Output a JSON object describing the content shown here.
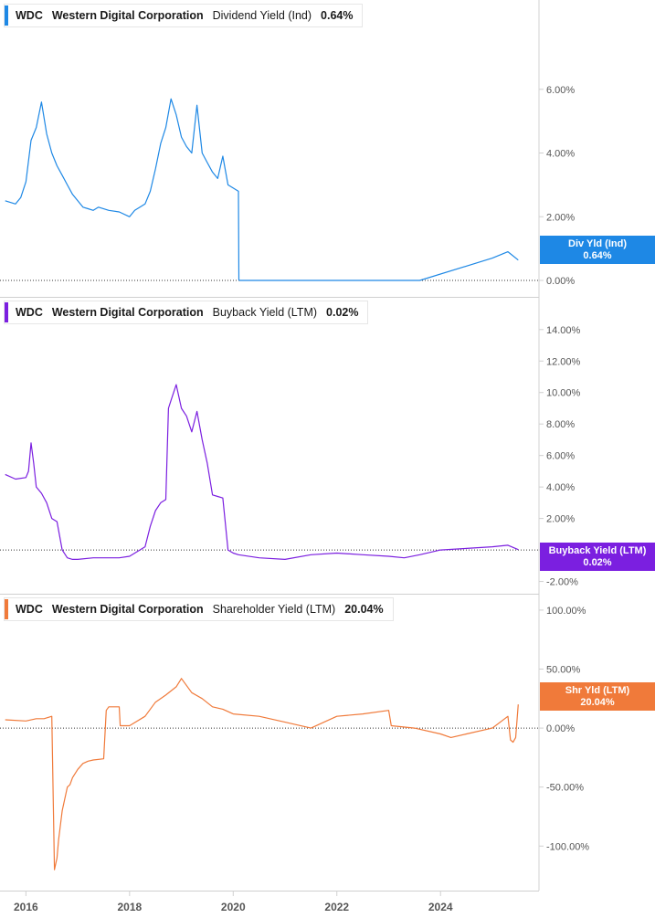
{
  "colors": {
    "dividend": "#1e88e5",
    "buyback": "#7b1fe0",
    "shareholder": "#f07a3a",
    "axis": "#d0d0d0",
    "text": "#555555"
  },
  "legends": [
    {
      "ticker": "WDC",
      "name": "Western Digital Corporation",
      "series": "Dividend Yield (Ind)",
      "value": "0.64%"
    },
    {
      "ticker": "WDC",
      "name": "Western Digital Corporation",
      "series": "Buyback Yield (LTM)",
      "value": "0.02%"
    },
    {
      "ticker": "WDC",
      "name": "Western Digital Corporation",
      "series": "Shareholder Yield (LTM)",
      "value": "20.04%"
    }
  ],
  "tags": [
    {
      "label": "Div Yld (Ind)",
      "value": "0.64%"
    },
    {
      "label": "Buyback Yield (LTM)",
      "value": "0.02%"
    },
    {
      "label": "Shr Yld (LTM)",
      "value": "20.04%"
    }
  ],
  "chart_data": [
    {
      "type": "line",
      "series_label": "Dividend Yield (Ind)",
      "ylim": [
        0,
        7.8
      ],
      "yticks": [
        "0.00%",
        "2.00%",
        "4.00%",
        "6.00%"
      ],
      "ytick_values": [
        0,
        2,
        4,
        6
      ],
      "x": [
        2015.6,
        2015.8,
        2015.9,
        2016.0,
        2016.1,
        2016.2,
        2016.3,
        2016.4,
        2016.5,
        2016.6,
        2016.7,
        2016.8,
        2016.9,
        2017.0,
        2017.1,
        2017.2,
        2017.3,
        2017.4,
        2017.6,
        2017.8,
        2018.0,
        2018.1,
        2018.2,
        2018.3,
        2018.4,
        2018.5,
        2018.6,
        2018.7,
        2018.8,
        2018.9,
        2019.0,
        2019.1,
        2019.2,
        2019.3,
        2019.4,
        2019.5,
        2019.6,
        2019.7,
        2019.8,
        2019.9,
        2020.0,
        2020.1,
        2020.11,
        2020.12,
        2020.5,
        2021.0,
        2022.0,
        2023.0,
        2023.5,
        2023.6,
        2025.0,
        2025.3,
        2025.5
      ],
      "values": [
        2.5,
        2.4,
        2.6,
        3.1,
        4.4,
        4.8,
        5.6,
        4.6,
        4.0,
        3.6,
        3.3,
        3.0,
        2.7,
        2.5,
        2.3,
        2.25,
        2.2,
        2.3,
        2.2,
        2.15,
        2.0,
        2.2,
        2.3,
        2.4,
        2.8,
        3.5,
        4.3,
        4.8,
        5.7,
        5.2,
        4.5,
        4.2,
        4.0,
        5.5,
        4.0,
        3.7,
        3.4,
        3.2,
        3.9,
        3.0,
        2.9,
        2.8,
        0.02,
        0.0,
        0.0,
        0.0,
        0.0,
        0.0,
        0.0,
        0.0,
        0.7,
        0.9,
        0.64
      ]
    },
    {
      "type": "line",
      "series_label": "Buyback Yield (LTM)",
      "ylim": [
        -2.2,
        14.8
      ],
      "yticks": [
        "-2.00%",
        "0.00%",
        "2.00%",
        "4.00%",
        "6.00%",
        "8.00%",
        "10.00%",
        "12.00%",
        "14.00%"
      ],
      "ytick_values": [
        -2,
        0,
        2,
        4,
        6,
        8,
        10,
        12,
        14
      ],
      "x": [
        2015.6,
        2015.8,
        2016.0,
        2016.05,
        2016.1,
        2016.15,
        2016.2,
        2016.3,
        2016.4,
        2016.5,
        2016.6,
        2016.7,
        2016.8,
        2016.9,
        2017.0,
        2017.3,
        2017.6,
        2017.8,
        2018.0,
        2018.3,
        2018.4,
        2018.5,
        2018.6,
        2018.7,
        2018.75,
        2018.8,
        2018.9,
        2019.0,
        2019.1,
        2019.2,
        2019.3,
        2019.4,
        2019.5,
        2019.6,
        2019.7,
        2019.8,
        2019.9,
        2020.0,
        2020.1,
        2020.5,
        2021.0,
        2021.5,
        2022.0,
        2022.5,
        2023.0,
        2023.3,
        2023.6,
        2024.0,
        2024.5,
        2025.0,
        2025.3,
        2025.5
      ],
      "values": [
        4.8,
        4.5,
        4.6,
        5.0,
        6.8,
        5.5,
        4.0,
        3.6,
        3.0,
        2.0,
        1.8,
        0.0,
        -0.5,
        -0.6,
        -0.6,
        -0.5,
        -0.5,
        -0.5,
        -0.4,
        0.2,
        1.5,
        2.5,
        3.0,
        3.2,
        9.0,
        9.5,
        10.5,
        9.0,
        8.5,
        7.5,
        8.8,
        7.0,
        5.5,
        3.5,
        3.4,
        3.3,
        0.0,
        -0.2,
        -0.3,
        -0.5,
        -0.6,
        -0.3,
        -0.2,
        -0.3,
        -0.4,
        -0.5,
        -0.3,
        0.0,
        0.1,
        0.2,
        0.3,
        0.02
      ]
    },
    {
      "type": "line",
      "series_label": "Shareholder Yield (LTM)",
      "ylim": [
        -130,
        110
      ],
      "yticks": [
        "-100.00%",
        "-50.00%",
        "0.00%",
        "50.00%",
        "100.00%"
      ],
      "ytick_values": [
        -100,
        -50,
        0,
        50,
        100
      ],
      "x": [
        2015.6,
        2016.0,
        2016.2,
        2016.35,
        2016.5,
        2016.55,
        2016.6,
        2016.63,
        2016.7,
        2016.75,
        2016.8,
        2016.85,
        2016.9,
        2017.0,
        2017.1,
        2017.2,
        2017.3,
        2017.5,
        2017.55,
        2017.6,
        2017.8,
        2017.82,
        2018.0,
        2018.3,
        2018.5,
        2018.7,
        2018.9,
        2019.0,
        2019.2,
        2019.4,
        2019.6,
        2019.8,
        2020.0,
        2020.5,
        2021.0,
        2021.5,
        2022.0,
        2022.5,
        2023.0,
        2023.05,
        2023.5,
        2024.0,
        2024.2,
        2024.5,
        2025.0,
        2025.3,
        2025.35,
        2025.4,
        2025.45,
        2025.5
      ],
      "values": [
        7,
        6,
        8,
        8,
        10,
        -120,
        -110,
        -95,
        -70,
        -60,
        -50,
        -48,
        -42,
        -35,
        -30,
        -28,
        -27,
        -26,
        15,
        18,
        18,
        2,
        2,
        10,
        22,
        28,
        35,
        42,
        30,
        25,
        18,
        16,
        12,
        10,
        5,
        0,
        10,
        12,
        15,
        2,
        0,
        -5,
        -8,
        -5,
        0,
        10,
        -10,
        -12,
        -8,
        20.04
      ]
    }
  ],
  "x_ticks": [
    "2016",
    "2018",
    "2020",
    "2022",
    "2024"
  ],
  "x_tick_values": [
    2016,
    2018,
    2020,
    2022,
    2024
  ],
  "x_range": [
    2015.5,
    2025.9
  ]
}
